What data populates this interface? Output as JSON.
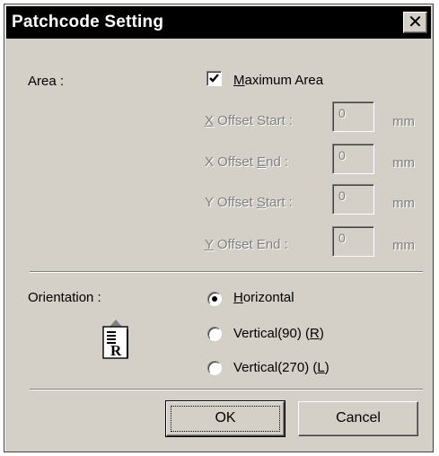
{
  "window": {
    "title": "Patchcode Setting",
    "close_glyph": "✕"
  },
  "area": {
    "label": "Area :",
    "max_area": {
      "checked": true,
      "label_u": "M",
      "label_rest": "aximum Area"
    },
    "fields": [
      {
        "label_pre": "",
        "label_u": "X",
        "label_post": " Offset Start :",
        "value": "0",
        "unit": "mm"
      },
      {
        "label_pre": "X Offset ",
        "label_u": "E",
        "label_post": "nd :",
        "value": "0",
        "unit": "mm"
      },
      {
        "label_pre": "Y Offset ",
        "label_u": "S",
        "label_post": "tart :",
        "value": "0",
        "unit": "mm"
      },
      {
        "label_pre": "",
        "label_u": "Y",
        "label_post": " Offset End :",
        "value": "0",
        "unit": "mm"
      }
    ]
  },
  "orientation": {
    "label": "Orientation :",
    "icon": "document-orientation-icon",
    "icon_letter": "R",
    "options": [
      {
        "label_pre": "",
        "label_u": "H",
        "label_post": "orizontal",
        "selected": true
      },
      {
        "label_pre": "Vertical(90) (",
        "label_u": "R",
        "label_post": ")",
        "selected": false
      },
      {
        "label_pre": "Vertical(270) (",
        "label_u": "L",
        "label_post": ")",
        "selected": false
      }
    ]
  },
  "buttons": {
    "ok": "OK",
    "cancel": "Cancel"
  },
  "colors": {
    "face": "#d4d0c8",
    "titlebar": "#000000",
    "disabled_text": "#808080"
  }
}
